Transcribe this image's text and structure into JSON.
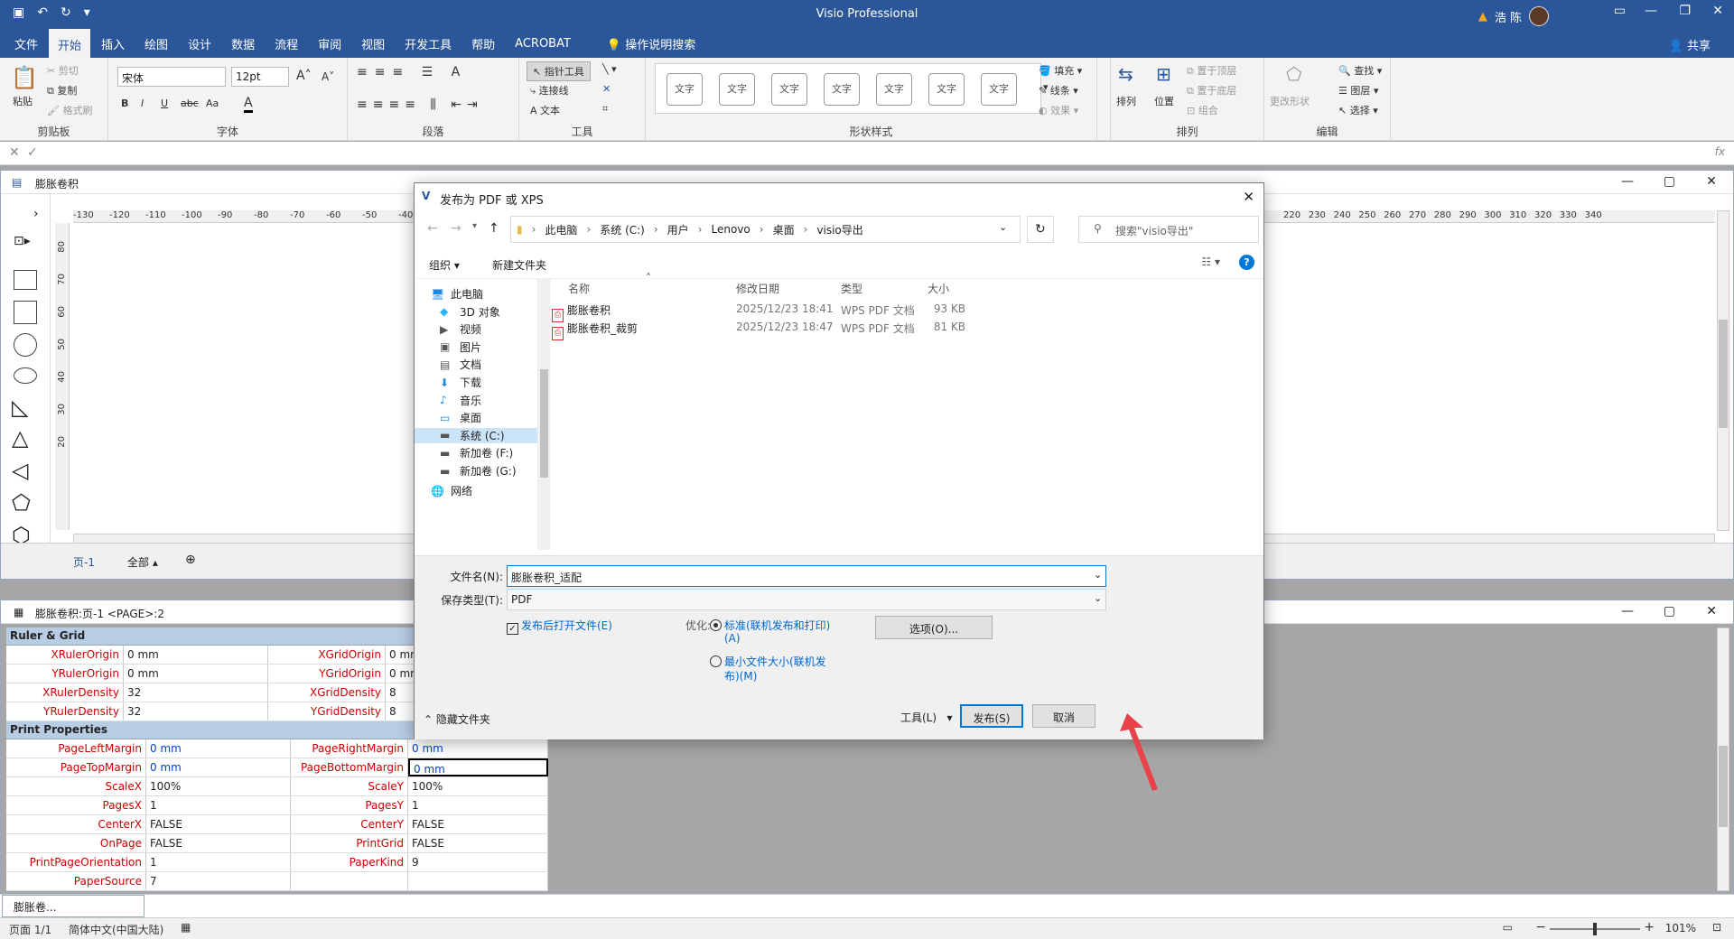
{
  "app": {
    "title": "Visio Professional",
    "user": "浩 陈"
  },
  "tabs": [
    "文件",
    "开始",
    "插入",
    "绘图",
    "设计",
    "数据",
    "流程",
    "审阅",
    "视图",
    "开发工具",
    "帮助",
    "ACROBAT"
  ],
  "tell_me": "操作说明搜索",
  "share": "共享",
  "ribbon": {
    "clipboard": {
      "paste": "粘贴",
      "cut": "剪切",
      "copy": "复制",
      "format_painter": "格式刷",
      "label": "剪贴板"
    },
    "font": {
      "name": "宋体",
      "size": "12pt",
      "label": "字体",
      "bold": "B",
      "italic": "I",
      "underline": "U",
      "strike": "abc",
      "case": "Aa",
      "color": "A"
    },
    "paragraph": {
      "label": "段落"
    },
    "tools": {
      "pointer": "指针工具",
      "connector": "连接线",
      "text": "文本",
      "label": "工具"
    },
    "shape_styles": {
      "label": "形状样式",
      "swatch_text": "文字",
      "fill": "填充",
      "line": "线条",
      "effects": "效果"
    },
    "arrange": {
      "arrange": "排列",
      "position": "位置",
      "bring_front": "置于顶层",
      "send_back": "置于底层",
      "group": "组合",
      "label": "排列"
    },
    "editing": {
      "change_shape": "更改形状",
      "find": "查找",
      "layers": "图层",
      "select": "选择",
      "label": "编辑"
    }
  },
  "drawing_window": {
    "title": "膨胀卷积",
    "ruler_left": [
      "-130",
      "-120",
      "-110",
      "-100",
      "-90",
      "-80",
      "-70",
      "-60",
      "-50",
      "-40"
    ],
    "ruler_right": [
      "220",
      "230",
      "240",
      "250",
      "260",
      "270",
      "280",
      "290",
      "300",
      "310",
      "320",
      "330",
      "340"
    ],
    "ruler_vertical": [
      "80",
      "70",
      "60",
      "50",
      "40",
      "30",
      "20"
    ],
    "page_tab": "页-1",
    "all_pages": "全部"
  },
  "shapesheet_window": {
    "title": "膨胀卷积:页-1 <PAGE>:2",
    "sections": [
      {
        "name": "Ruler & Grid",
        "rows": [
          [
            "XRulerOrigin",
            "0 mm",
            "XGridOrigin",
            "0 mm"
          ],
          [
            "YRulerOrigin",
            "0 mm",
            "YGridOrigin",
            "0 mm"
          ],
          [
            "XRulerDensity",
            "32",
            "XGridDensity",
            "8"
          ],
          [
            "YRulerDensity",
            "32",
            "YGridDensity",
            "8"
          ]
        ]
      },
      {
        "name": "Print Properties",
        "rows": [
          [
            "PageLeftMargin",
            "0 mm",
            "PageRightMargin",
            "0 mm"
          ],
          [
            "PageTopMargin",
            "0 mm",
            "PageBottomMargin",
            "0 mm"
          ],
          [
            "ScaleX",
            "100%",
            "ScaleY",
            "100%"
          ],
          [
            "PagesX",
            "1",
            "PagesY",
            "1"
          ],
          [
            "CenterX",
            "FALSE",
            "CenterY",
            "FALSE"
          ],
          [
            "OnPage",
            "FALSE",
            "PrintGrid",
            "FALSE"
          ],
          [
            "PrintPageOrientation",
            "1",
            "PaperKind",
            "9"
          ],
          [
            "PaperSource",
            "7",
            "",
            ""
          ]
        ]
      }
    ]
  },
  "bottom_tab": "膨胀卷...",
  "status": {
    "page": "页面 1/1",
    "lang": "简体中文(中国大陆)",
    "zoom": "101%"
  },
  "dialog": {
    "title": "发布为 PDF 或 XPS",
    "breadcrumb": [
      "此电脑",
      "系统 (C:)",
      "用户",
      "Lenovo",
      "桌面",
      "visio导出"
    ],
    "search_placeholder": "搜索\"visio导出\"",
    "organize": "组织",
    "new_folder": "新建文件夹",
    "nav": [
      "此电脑",
      "3D 对象",
      "视频",
      "图片",
      "文档",
      "下载",
      "音乐",
      "桌面",
      "系统 (C:)",
      "新加卷 (F:)",
      "新加卷 (G:)",
      "网络"
    ],
    "columns": [
      "名称",
      "修改日期",
      "类型",
      "大小"
    ],
    "files": [
      {
        "name": "膨胀卷积",
        "date": "2025/12/23 18:41",
        "type": "WPS PDF 文档",
        "size": "93 KB"
      },
      {
        "name": "膨胀卷积_裁剪",
        "date": "2025/12/23 18:47",
        "type": "WPS PDF 文档",
        "size": "81 KB"
      }
    ],
    "filename_label": "文件名(N):",
    "filename": "膨胀卷积_适配",
    "filetype_label": "保存类型(T):",
    "filetype": "PDF",
    "open_after": "发布后打开文件(E)",
    "optimize_label": "优化:",
    "opt_standard": "标准(联机发布和打印)",
    "opt_standard_key": "(A)",
    "opt_min": "最小文件大小(联机发",
    "opt_min2": "布)(M)",
    "options_btn": "选项(O)...",
    "hide_folders": "隐藏文件夹",
    "tools": "工具(L)",
    "publish": "发布(S)",
    "cancel": "取消"
  }
}
